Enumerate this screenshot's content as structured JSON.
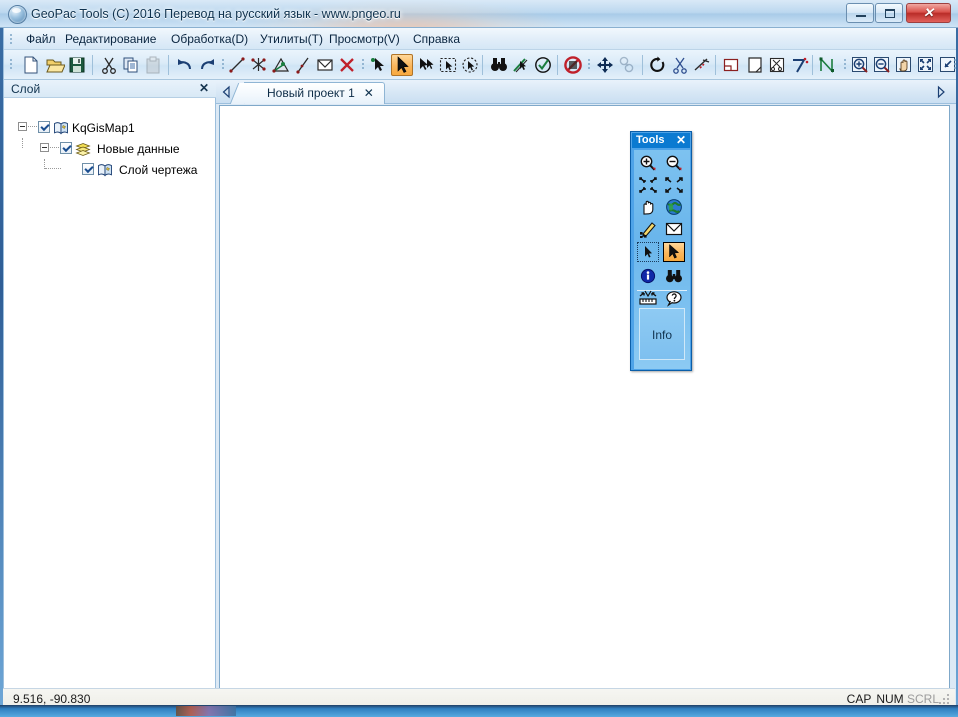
{
  "window": {
    "title": "GeoPac Tools (C) 2016 Перевод на русский язык - www.pngeo.ru",
    "app_icon": "globe-icon",
    "minimize_label": "",
    "maximize_label": "",
    "close_label": "✕"
  },
  "menu": {
    "items": [
      {
        "label": "Файл",
        "accel": "Ф"
      },
      {
        "label": "Редактирование",
        "accel": ""
      },
      {
        "label": "Обработка(D)",
        "accel": "D"
      },
      {
        "label": "Утилиты(T)",
        "accel": "T"
      },
      {
        "label": "Просмотр(V)",
        "accel": "V"
      },
      {
        "label": "Справка",
        "accel": "С"
      }
    ]
  },
  "toolbar": {
    "groups": [
      {
        "name": "file-group",
        "buttons": [
          {
            "icon": "new-document-icon",
            "enabled": true
          },
          {
            "icon": "open-folder-icon",
            "enabled": true
          },
          {
            "icon": "save-disk-icon",
            "enabled": true
          }
        ]
      },
      {
        "name": "clipboard-group",
        "buttons": [
          {
            "icon": "cut-scissors-icon",
            "enabled": true
          },
          {
            "icon": "copy-icon",
            "enabled": true
          },
          {
            "icon": "paste-icon",
            "enabled": false
          }
        ]
      },
      {
        "name": "history-group",
        "buttons": [
          {
            "icon": "undo-arrow-icon",
            "enabled": true
          },
          {
            "icon": "redo-arrow-icon",
            "enabled": true
          }
        ]
      },
      {
        "name": "draw-group",
        "buttons": [
          {
            "icon": "draw-line-icon",
            "enabled": true
          },
          {
            "icon": "draw-point-star-icon",
            "enabled": true
          },
          {
            "icon": "draw-polygon-icon",
            "enabled": true
          },
          {
            "icon": "draw-polyline-icon",
            "enabled": true
          },
          {
            "icon": "draw-envelope-icon",
            "enabled": true
          },
          {
            "icon": "delete-cross-icon",
            "enabled": true
          }
        ]
      },
      {
        "name": "select-group",
        "buttons": [
          {
            "icon": "vertex-select-icon",
            "enabled": true
          },
          {
            "icon": "arrow-select-icon",
            "enabled": true,
            "active": true
          },
          {
            "icon": "multi-select-icon",
            "enabled": true
          },
          {
            "icon": "rectangle-select-icon",
            "enabled": true
          },
          {
            "icon": "lasso-select-icon",
            "enabled": true
          },
          {
            "icon": "find-binoculars-icon",
            "enabled": true
          },
          {
            "icon": "measure-pen-icon",
            "enabled": true
          },
          {
            "icon": "check-circle-icon",
            "enabled": true
          },
          {
            "icon": "no-entry-icon",
            "enabled": true
          }
        ]
      },
      {
        "name": "transform-group",
        "buttons": [
          {
            "icon": "move-arrows-icon",
            "enabled": true
          },
          {
            "icon": "copy-shapes-icon",
            "enabled": false
          },
          {
            "icon": "rotate-icon",
            "enabled": true
          },
          {
            "icon": "split-scissors-icon",
            "enabled": true
          },
          {
            "icon": "trim-line-icon",
            "enabled": true
          }
        ]
      },
      {
        "name": "edit-shape-group",
        "buttons": [
          {
            "icon": "square-corner-icon",
            "enabled": true
          },
          {
            "icon": "page-fold-icon",
            "enabled": true
          },
          {
            "icon": "cut-page-icon",
            "enabled": true
          },
          {
            "icon": "angle-seven-icon",
            "enabled": true
          },
          {
            "icon": "node-snap-icon",
            "enabled": true
          }
        ]
      },
      {
        "name": "zoom-group",
        "buttons": [
          {
            "icon": "zoom-in-icon",
            "enabled": true
          },
          {
            "icon": "zoom-out-icon",
            "enabled": true
          },
          {
            "icon": "pan-hand-icon",
            "enabled": true
          },
          {
            "icon": "zoom-extent-icon",
            "enabled": true
          },
          {
            "icon": "zoom-window-icon",
            "enabled": true
          }
        ]
      }
    ]
  },
  "layer_panel": {
    "title": "Слой",
    "close_label": "✕",
    "tree": [
      {
        "label": "KqGisMap1",
        "icon": "map-book-icon",
        "checked": true,
        "expanded": true,
        "depth": 0
      },
      {
        "label": "Новые данные",
        "icon": "layers-stack-icon",
        "checked": true,
        "expanded": true,
        "depth": 1
      },
      {
        "label": "Слой чертежа",
        "icon": "map-book-icon",
        "checked": true,
        "expanded": null,
        "depth": 2
      }
    ],
    "hscroll": {
      "left_arrow": "◄",
      "right_arrow": "►",
      "thumb_grip": "|||"
    }
  },
  "document_area": {
    "tab_left_arrow": "◁",
    "tab_right_arrow": "▷",
    "tabs": [
      {
        "label": "Новый проект 1",
        "close_label": "✕",
        "active": true
      }
    ]
  },
  "tools_palette": {
    "title": "Tools",
    "close_label": "✕",
    "buttons": [
      {
        "icon": "zoom-in-icon",
        "row": 0,
        "col": 0
      },
      {
        "icon": "zoom-out-icon",
        "row": 0,
        "col": 1
      },
      {
        "icon": "zoom-shrink-icon",
        "row": 1,
        "col": 0
      },
      {
        "icon": "zoom-expand-icon",
        "row": 1,
        "col": 1
      },
      {
        "icon": "pan-hand-icon",
        "row": 2,
        "col": 0
      },
      {
        "icon": "globe-earth-icon",
        "row": 2,
        "col": 1
      },
      {
        "icon": "pencil-edit-icon",
        "row": 3,
        "col": 0
      },
      {
        "icon": "envelope-icon",
        "row": 3,
        "col": 1
      },
      {
        "icon": "rectangle-select-icon",
        "row": 4,
        "col": 0,
        "framed": true
      },
      {
        "icon": "arrow-select-icon",
        "row": 4,
        "col": 1,
        "active": true
      },
      {
        "icon": "info-circle-icon",
        "row": 5,
        "col": 0
      },
      {
        "icon": "find-binoculars-icon",
        "row": 5,
        "col": 1
      },
      {
        "icon": "measure-ruler-icon",
        "row": 6,
        "col": 0
      },
      {
        "icon": "help-bubble-icon",
        "row": 6,
        "col": 1
      }
    ],
    "info_panel_label": "Info"
  },
  "status_bar": {
    "coordinates": "9.516, -90.830",
    "indicators": [
      {
        "label": "CAP",
        "active": true
      },
      {
        "label": "NUM",
        "active": true
      },
      {
        "label": "SCRL",
        "active": false
      }
    ]
  },
  "colors": {
    "accent_blue": "#0b7ad1",
    "palette_body": "#7dc2f0",
    "active_tool_orange": "#fbb65c",
    "title_text": "#10334f",
    "close_button_red": "#b92c28"
  }
}
